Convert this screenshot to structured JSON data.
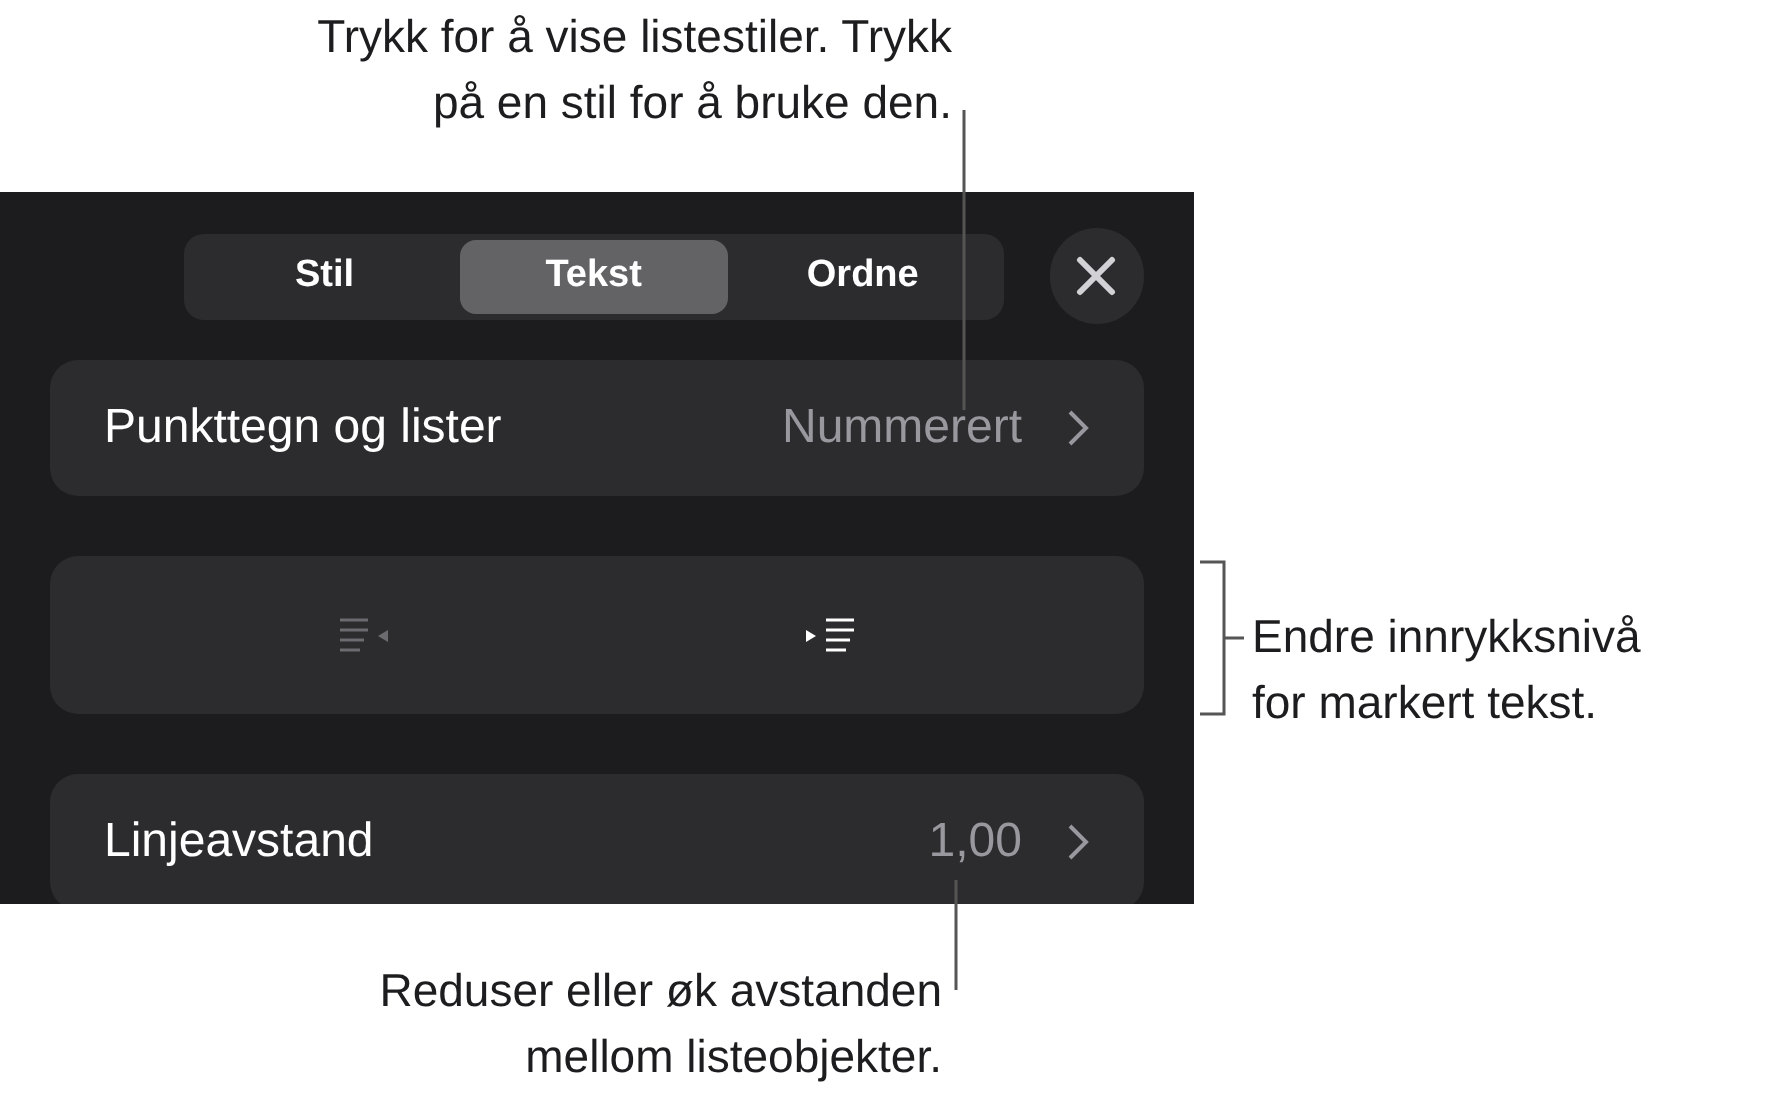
{
  "callouts": [
    {
      "kind": "top",
      "lines": [
        "Trykk for å vise listestiler. Trykk",
        "på en stil for å bruke den."
      ]
    },
    {
      "kind": "right",
      "lines": [
        "Endre innrykksnivå",
        "for markert tekst."
      ]
    },
    {
      "kind": "bottom",
      "lines": [
        "Reduser eller øk avstanden",
        "mellom listeobjekter."
      ]
    }
  ],
  "tabs": [
    {
      "label": "Stil",
      "selected": false
    },
    {
      "label": "Tekst",
      "selected": true
    },
    {
      "label": "Ordne",
      "selected": false
    }
  ],
  "rows": [
    {
      "kind": "nav",
      "label": "Punkttegn og lister",
      "value": "Nummerert"
    },
    {
      "kind": "indent",
      "buttons": [
        {
          "kind": "decrease",
          "disabled": true
        },
        {
          "kind": "increase",
          "disabled": false
        }
      ]
    },
    {
      "kind": "nav",
      "label": "Linjeavstand",
      "value": "1,00"
    }
  ]
}
